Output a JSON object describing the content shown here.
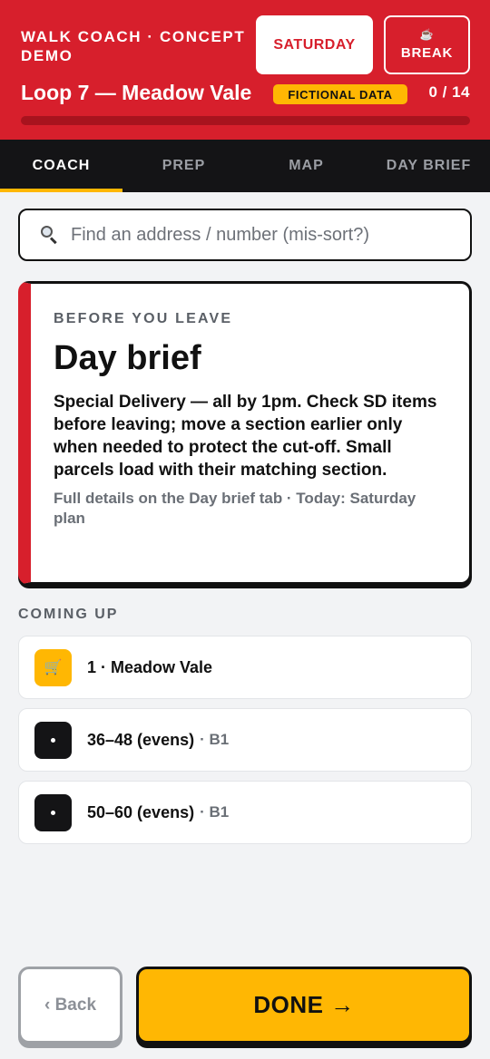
{
  "header": {
    "kicker": "WALK COACH · CONCEPT DEMO",
    "day_button": "SATURDAY",
    "break_button": {
      "icon": "coffee-cup-icon",
      "glyph": "☕",
      "label": "BREAK"
    },
    "loop_title": "Loop 7 — Meadow Vale",
    "badge": "FICTIONAL DATA",
    "progress_text": "0 / 14",
    "progress_fraction": 0
  },
  "tabs": [
    {
      "label": "COACH",
      "active": true
    },
    {
      "label": "PREP",
      "active": false
    },
    {
      "label": "MAP",
      "active": false
    },
    {
      "label": "DAY BRIEF",
      "active": false
    }
  ],
  "search": {
    "placeholder": "Find an address / number (mis-sort?)",
    "value": ""
  },
  "brief": {
    "kicker": "BEFORE YOU LEAVE",
    "title": "Day brief",
    "body": "Special Delivery — all by 1pm. Check SD items before leaving; move a section earlier only when needed to protect the cut-off. Small parcels load with their matching section.",
    "footer": "Full details on the Day brief tab · Today: Saturday plan"
  },
  "coming_up": {
    "label": "COMING UP",
    "items": [
      {
        "icon": "shopping-cart-icon",
        "glyph": "🛒",
        "label": "1 · Meadow Vale",
        "meta": ""
      },
      {
        "icon": "dot-icon",
        "glyph": "",
        "label": "36–48 (evens)",
        "meta": "· B1"
      },
      {
        "icon": "dot-icon",
        "glyph": "",
        "label": "50–60 (evens)",
        "meta": "· B1"
      }
    ]
  },
  "footer": {
    "back_label": "‹ Back",
    "done_label": "DONE →"
  },
  "colors": {
    "brand_red": "#d71f2c",
    "accent_yellow": "#ffb703",
    "dark": "#141416"
  }
}
